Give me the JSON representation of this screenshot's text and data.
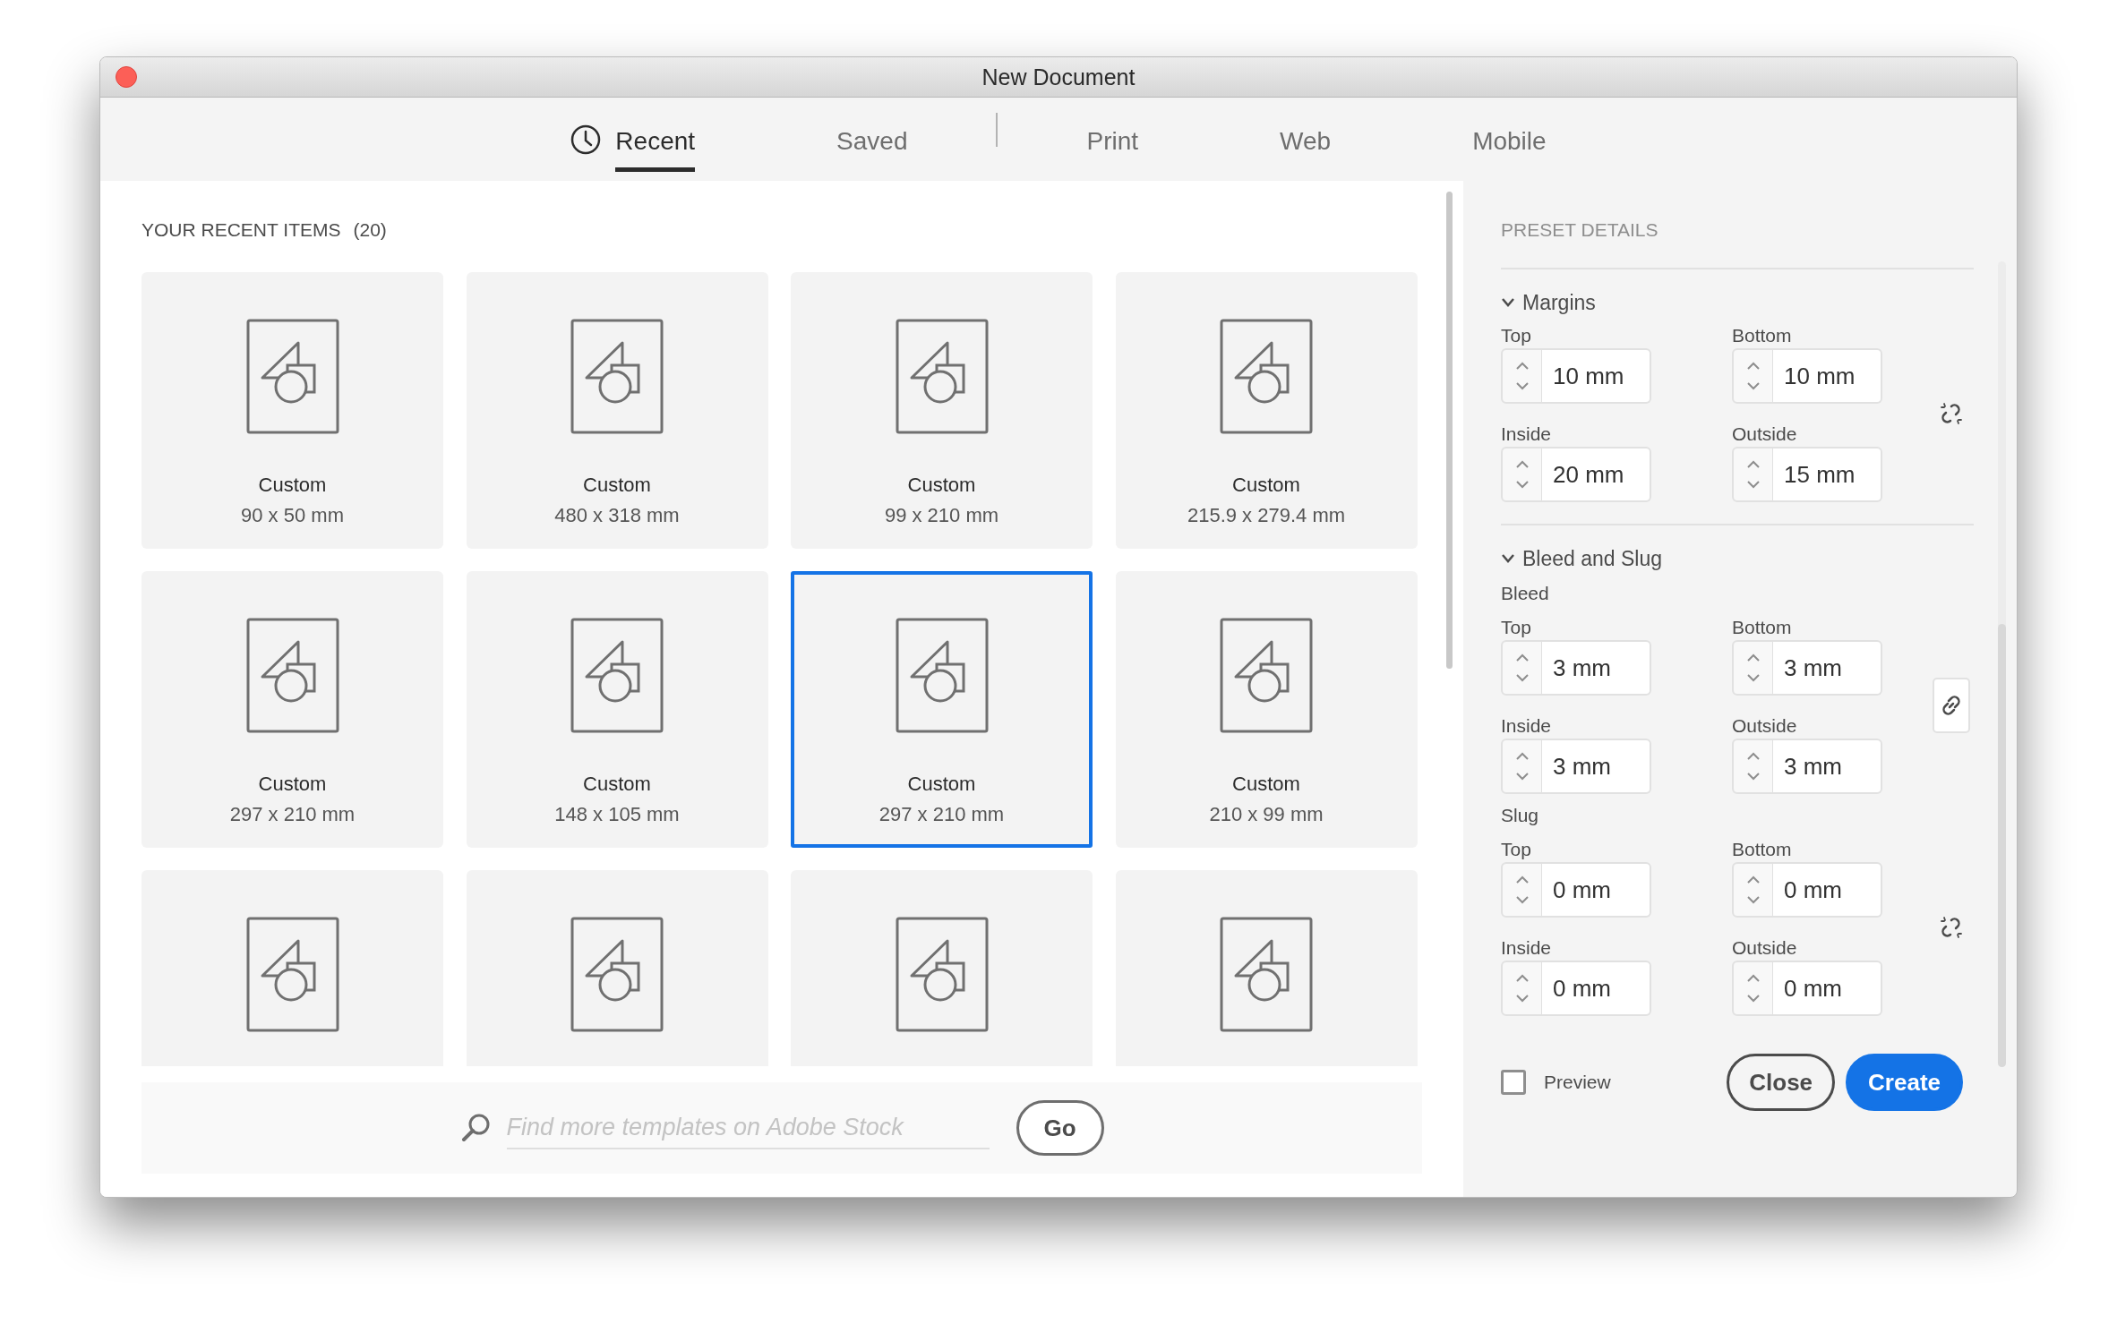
{
  "window": {
    "title": "New Document"
  },
  "tabs": [
    {
      "label": "Recent",
      "kind": "history",
      "selected": true
    },
    {
      "label": "Saved",
      "kind": "history",
      "selected": false
    },
    {
      "label": "Print",
      "kind": "preset",
      "selected": false
    },
    {
      "label": "Web",
      "kind": "preset",
      "selected": false
    },
    {
      "label": "Mobile",
      "kind": "preset",
      "selected": false
    }
  ],
  "recent": {
    "heading": "YOUR RECENT ITEMS",
    "count": "(20)",
    "items": [
      {
        "name": "Custom",
        "size": "90 x 50 mm",
        "selected": false
      },
      {
        "name": "Custom",
        "size": "480 x 318 mm",
        "selected": false
      },
      {
        "name": "Custom",
        "size": "99 x 210 mm",
        "selected": false
      },
      {
        "name": "Custom",
        "size": "215.9 x 279.4 mm",
        "selected": false
      },
      {
        "name": "Custom",
        "size": "297 x 210 mm",
        "selected": false
      },
      {
        "name": "Custom",
        "size": "148 x 105 mm",
        "selected": false
      },
      {
        "name": "Custom",
        "size": "297 x 210 mm",
        "selected": true
      },
      {
        "name": "Custom",
        "size": "210 x 99 mm",
        "selected": false
      },
      {
        "selected": false
      },
      {
        "selected": false
      },
      {
        "selected": false
      },
      {
        "selected": false
      }
    ]
  },
  "search": {
    "placeholder": "Find more templates on Adobe Stock",
    "button": "Go"
  },
  "preset_details": {
    "heading": "PRESET DETAILS",
    "sections": [
      {
        "title": "Margins",
        "expanded": true,
        "groups": [
          {
            "linked": false,
            "fields": [
              {
                "label": "Top",
                "value": "10 mm"
              },
              {
                "label": "Bottom",
                "value": "10 mm"
              },
              {
                "label": "Inside",
                "value": "20 mm"
              },
              {
                "label": "Outside",
                "value": "15 mm"
              }
            ]
          }
        ]
      },
      {
        "title": "Bleed and Slug",
        "expanded": true,
        "groups": [
          {
            "title": "Bleed",
            "linked": true,
            "fields": [
              {
                "label": "Top",
                "value": "3 mm"
              },
              {
                "label": "Bottom",
                "value": "3 mm"
              },
              {
                "label": "Inside",
                "value": "3 mm"
              },
              {
                "label": "Outside",
                "value": "3 mm"
              }
            ]
          },
          {
            "title": "Slug",
            "linked": false,
            "fields": [
              {
                "label": "Top",
                "value": "0 mm"
              },
              {
                "label": "Bottom",
                "value": "0 mm"
              },
              {
                "label": "Inside",
                "value": "0 mm"
              },
              {
                "label": "Outside",
                "value": "0 mm"
              }
            ]
          }
        ]
      }
    ]
  },
  "preview": {
    "label": "Preview",
    "checked": false
  },
  "buttons": [
    {
      "label": "Close",
      "kind": "secondary"
    },
    {
      "label": "Create",
      "kind": "primary"
    }
  ]
}
